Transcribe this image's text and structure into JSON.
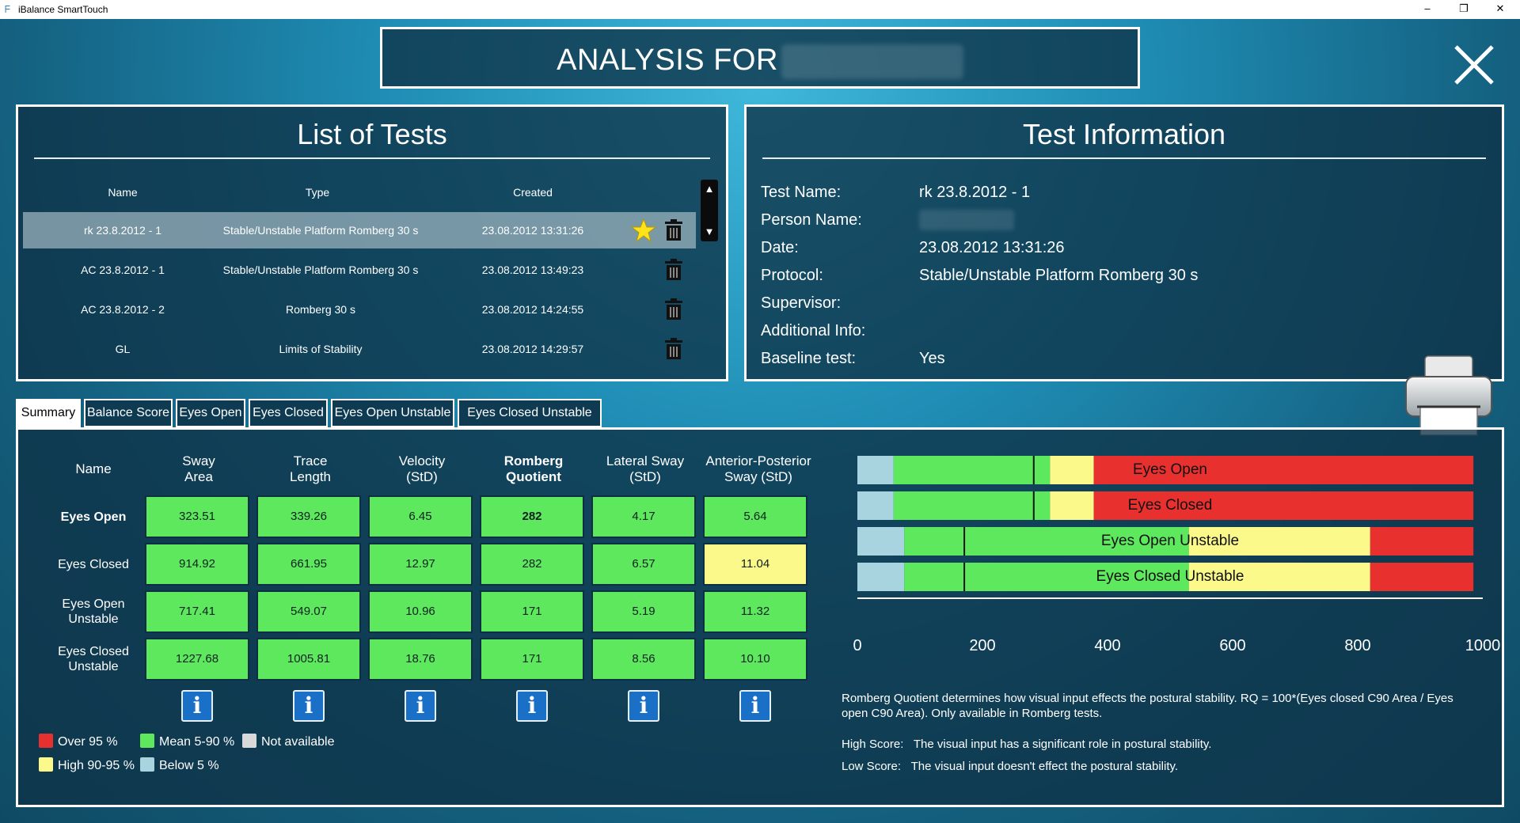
{
  "app": {
    "title": "iBalance SmartTouch",
    "window_controls": [
      "–",
      "❐",
      "✕"
    ]
  },
  "header": {
    "title": "ANALYSIS FOR"
  },
  "list_of_tests": {
    "title": "List of Tests",
    "columns": [
      "Name",
      "Type",
      "Created"
    ],
    "rows": [
      {
        "name": "rk 23.8.2012 - 1",
        "type": "Stable/Unstable Platform Romberg 30 s",
        "created": "23.08.2012 13:31:26",
        "selected": true,
        "baseline": true
      },
      {
        "name": "AC 23.8.2012 - 1",
        "type": "Stable/Unstable Platform Romberg 30 s",
        "created": "23.08.2012 13:49:23"
      },
      {
        "name": "AC 23.8.2012 - 2",
        "type": "Romberg 30 s",
        "created": "23.08.2012 14:24:55"
      },
      {
        "name": "GL",
        "type": "Limits of Stability",
        "created": "23.08.2012 14:29:57"
      }
    ]
  },
  "test_information": {
    "title": "Test Information",
    "rows": [
      {
        "key": "Test Name:",
        "value": "rk 23.8.2012 - 1"
      },
      {
        "key": "Person Name:",
        "value": ""
      },
      {
        "key": "Date:",
        "value": "23.08.2012 13:31:26"
      },
      {
        "key": "Protocol:",
        "value": "Stable/Unstable Platform Romberg 30 s"
      },
      {
        "key": "Supervisor:",
        "value": ""
      },
      {
        "key": "Additional Info:",
        "value": ""
      },
      {
        "key": "Baseline test:",
        "value": "Yes"
      }
    ]
  },
  "tabs": [
    "Summary",
    "Balance Score",
    "Eyes Open",
    "Eyes Closed",
    "Eyes Open Unstable",
    "Eyes Closed Unstable"
  ],
  "summary": {
    "name_header": "Name",
    "columns": [
      {
        "l1": "Sway",
        "l2": "Area",
        "bold": false
      },
      {
        "l1": "Trace",
        "l2": "Length",
        "bold": false
      },
      {
        "l1": "Velocity",
        "l2": "(StD)",
        "bold": false
      },
      {
        "l1": "Romberg",
        "l2": "Quotient",
        "bold": true
      },
      {
        "l1": "Lateral Sway",
        "l2": "(StD)",
        "bold": false
      },
      {
        "l1": "Anterior-Posterior",
        "l2": "Sway (StD)",
        "bold": false
      }
    ],
    "rows": [
      {
        "l1": "Eyes Open",
        "l2": "",
        "bold": true,
        "values": [
          "323.51",
          "339.26",
          "6.45",
          "282",
          "4.17",
          "5.64"
        ],
        "colors": [
          "g",
          "g",
          "g",
          "g",
          "g",
          "g"
        ]
      },
      {
        "l1": "Eyes Closed",
        "l2": "",
        "bold": false,
        "values": [
          "914.92",
          "661.95",
          "12.97",
          "282",
          "6.57",
          "11.04"
        ],
        "colors": [
          "g",
          "g",
          "g",
          "g",
          "g",
          "y"
        ]
      },
      {
        "l1": "Eyes Open",
        "l2": "Unstable",
        "bold": false,
        "values": [
          "717.41",
          "549.07",
          "10.96",
          "171",
          "5.19",
          "11.32"
        ],
        "colors": [
          "g",
          "g",
          "g",
          "g",
          "g",
          "g"
        ]
      },
      {
        "l1": "Eyes Closed",
        "l2": "Unstable",
        "bold": false,
        "values": [
          "1227.68",
          "1005.81",
          "18.76",
          "171",
          "8.56",
          "10.10"
        ],
        "colors": [
          "g",
          "g",
          "g",
          "g",
          "g",
          "g"
        ]
      }
    ],
    "info_button_label": "i",
    "legend": [
      {
        "label": "Over 95 %",
        "color": "#e8302f"
      },
      {
        "label": "Mean 5-90 %",
        "color": "#5de85e"
      },
      {
        "label": "Not available",
        "color": "#d9d9d9"
      },
      {
        "label": "High 90-95 %",
        "color": "#fbf98a"
      },
      {
        "label": "Below 5 %",
        "color": "#a8d4e0"
      }
    ]
  },
  "chart_data": {
    "type": "bar",
    "orientation": "horizontal",
    "stacked": true,
    "xlim": [
      0,
      1000
    ],
    "xticks": [
      0,
      200,
      400,
      600,
      800,
      1000
    ],
    "categories": [
      "Eyes Open",
      "Eyes Closed",
      "Eyes Open Unstable",
      "Eyes Closed Unstable"
    ],
    "bands": [
      [
        {
          "to": 58,
          "color": "#a8d4e0"
        },
        {
          "to": 308,
          "color": "#5de85e"
        },
        {
          "to": 378,
          "color": "#fbf98a"
        },
        {
          "to": 985,
          "color": "#e8302f"
        }
      ],
      [
        {
          "to": 58,
          "color": "#a8d4e0"
        },
        {
          "to": 308,
          "color": "#5de85e"
        },
        {
          "to": 378,
          "color": "#fbf98a"
        },
        {
          "to": 985,
          "color": "#e8302f"
        }
      ],
      [
        {
          "to": 75,
          "color": "#a8d4e0"
        },
        {
          "to": 530,
          "color": "#5de85e"
        },
        {
          "to": 820,
          "color": "#fbf98a"
        },
        {
          "to": 985,
          "color": "#e8302f"
        }
      ],
      [
        {
          "to": 75,
          "color": "#a8d4e0"
        },
        {
          "to": 530,
          "color": "#5de85e"
        },
        {
          "to": 820,
          "color": "#fbf98a"
        },
        {
          "to": 985,
          "color": "#e8302f"
        }
      ]
    ],
    "markers": [
      282,
      282,
      171,
      171
    ],
    "series_colors": {
      "below": "#a8d4e0",
      "mean": "#5de85e",
      "high": "#fbf98a",
      "over": "#e8302f"
    }
  },
  "notes": {
    "romberg_1": "Romberg Quotient determines how visual input effects the postural stability. RQ = 100*(Eyes closed C90 Area / Eyes",
    "romberg_2": "open C90 Area). Only available in Romberg tests.",
    "high_key": "High Score:",
    "high_val": "The visual input has a significant role in postural stability.",
    "low_key": "Low Score:",
    "low_val": "The visual input doesn't effect the postural stability."
  }
}
